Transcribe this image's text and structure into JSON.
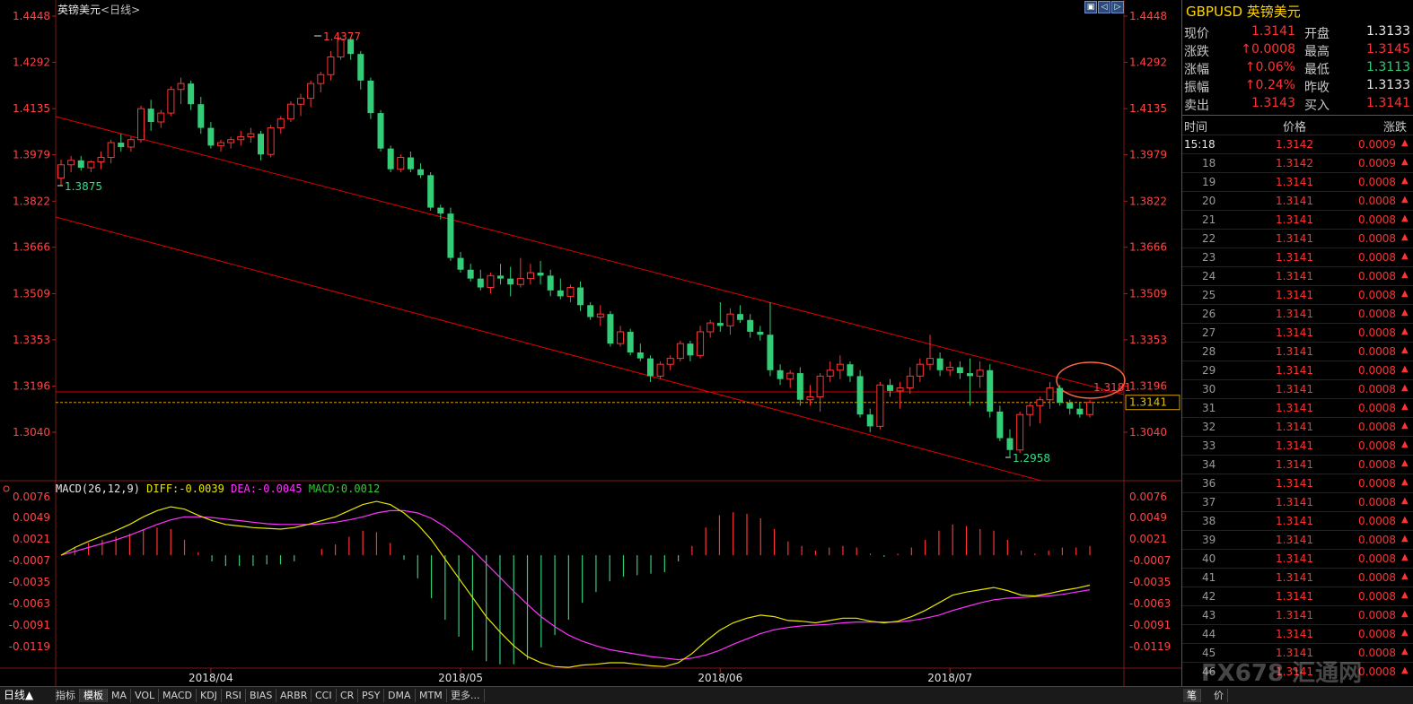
{
  "instrument": {
    "name": "英镑美元",
    "period": "<日线>"
  },
  "window_buttons": [
    "▣",
    "◁",
    "▷"
  ],
  "price_axis": [
    "1.4448",
    "1.4292",
    "1.4135",
    "1.3979",
    "1.3822",
    "1.3666",
    "1.3509",
    "1.3353",
    "1.3196",
    "1.3040"
  ],
  "macd_axis": [
    "0.0076",
    "0.0049",
    "0.0021",
    "-0.0007",
    "-0.0035",
    "-0.0063",
    "-0.0091",
    "-0.0119"
  ],
  "date_labels": [
    "2018/04",
    "2018/05",
    "2018/06",
    "2018/07"
  ],
  "annotations": {
    "high": "1.4377",
    "low": "1.2958",
    "start_low": "1.3875",
    "level": "1.3181",
    "last_price": "1.3141"
  },
  "macd_header": {
    "params": "MACD(26,12,9)",
    "diff": "DIFF:-0.0039",
    "dea": "DEA:-0.0045",
    "macd": "MACD:0.0012"
  },
  "colors": {
    "up": "#ff3333",
    "down": "#33cc77",
    "trendline": "#e00000",
    "diff": "#e6e600",
    "dea": "#ff33ff",
    "circle": "#ff6644"
  },
  "chart_data": {
    "type": "candlestick",
    "title": "英镑美元<日线>",
    "ylim": [
      1.2958,
      1.4448
    ],
    "candles": [
      [
        1.39,
        1.3962,
        1.3875,
        1.3945
      ],
      [
        1.3945,
        1.3975,
        1.392,
        1.396
      ],
      [
        1.396,
        1.3975,
        1.3925,
        1.3935
      ],
      [
        1.3935,
        1.396,
        1.392,
        1.3955
      ],
      [
        1.3955,
        1.399,
        1.393,
        1.397
      ],
      [
        1.397,
        1.403,
        1.395,
        1.402
      ],
      [
        1.402,
        1.405,
        1.399,
        1.4005
      ],
      [
        1.4005,
        1.404,
        1.399,
        1.403
      ],
      [
        1.403,
        1.4145,
        1.402,
        1.4135
      ],
      [
        1.4135,
        1.4165,
        1.406,
        1.409
      ],
      [
        1.409,
        1.413,
        1.407,
        1.412
      ],
      [
        1.412,
        1.421,
        1.411,
        1.42
      ],
      [
        1.42,
        1.424,
        1.415,
        1.422
      ],
      [
        1.422,
        1.423,
        1.413,
        1.415
      ],
      [
        1.415,
        1.4175,
        1.405,
        1.407
      ],
      [
        1.407,
        1.409,
        1.4,
        1.401
      ],
      [
        1.401,
        1.403,
        1.399,
        1.402
      ],
      [
        1.402,
        1.404,
        1.4,
        1.403
      ],
      [
        1.403,
        1.406,
        1.401,
        1.404
      ],
      [
        1.404,
        1.407,
        1.402,
        1.405
      ],
      [
        1.405,
        1.406,
        1.396,
        1.398
      ],
      [
        1.398,
        1.408,
        1.397,
        1.407
      ],
      [
        1.407,
        1.411,
        1.405,
        1.41
      ],
      [
        1.41,
        1.416,
        1.409,
        1.415
      ],
      [
        1.415,
        1.4185,
        1.411,
        1.417
      ],
      [
        1.417,
        1.423,
        1.414,
        1.422
      ],
      [
        1.422,
        1.426,
        1.419,
        1.425
      ],
      [
        1.425,
        1.433,
        1.423,
        1.431
      ],
      [
        1.431,
        1.4377,
        1.43,
        1.437
      ],
      [
        1.437,
        1.4375,
        1.43,
        1.432
      ],
      [
        1.432,
        1.433,
        1.42,
        1.423
      ],
      [
        1.423,
        1.424,
        1.41,
        1.412
      ],
      [
        1.412,
        1.413,
        1.399,
        1.4
      ],
      [
        1.4,
        1.401,
        1.392,
        1.393
      ],
      [
        1.393,
        1.398,
        1.392,
        1.397
      ],
      [
        1.397,
        1.399,
        1.392,
        1.393
      ],
      [
        1.393,
        1.395,
        1.39,
        1.391
      ],
      [
        1.391,
        1.392,
        1.379,
        1.38
      ],
      [
        1.38,
        1.381,
        1.376,
        1.378
      ],
      [
        1.378,
        1.38,
        1.362,
        1.363
      ],
      [
        1.363,
        1.365,
        1.358,
        1.359
      ],
      [
        1.359,
        1.361,
        1.355,
        1.356
      ],
      [
        1.356,
        1.359,
        1.352,
        1.353
      ],
      [
        1.353,
        1.358,
        1.351,
        1.357
      ],
      [
        1.357,
        1.361,
        1.354,
        1.356
      ],
      [
        1.356,
        1.36,
        1.35,
        1.354
      ],
      [
        1.354,
        1.363,
        1.353,
        1.356
      ],
      [
        1.356,
        1.361,
        1.354,
        1.358
      ],
      [
        1.358,
        1.362,
        1.354,
        1.357
      ],
      [
        1.357,
        1.359,
        1.35,
        1.352
      ],
      [
        1.352,
        1.356,
        1.349,
        1.35
      ],
      [
        1.35,
        1.354,
        1.348,
        1.353
      ],
      [
        1.353,
        1.355,
        1.345,
        1.347
      ],
      [
        1.347,
        1.348,
        1.342,
        1.343
      ],
      [
        1.343,
        1.347,
        1.34,
        1.344
      ],
      [
        1.344,
        1.345,
        1.333,
        1.334
      ],
      [
        1.334,
        1.34,
        1.333,
        1.338
      ],
      [
        1.338,
        1.339,
        1.33,
        1.331
      ],
      [
        1.331,
        1.334,
        1.328,
        1.329
      ],
      [
        1.329,
        1.33,
        1.321,
        1.323
      ],
      [
        1.323,
        1.328,
        1.322,
        1.327
      ],
      [
        1.327,
        1.33,
        1.325,
        1.329
      ],
      [
        1.329,
        1.335,
        1.328,
        1.334
      ],
      [
        1.334,
        1.335,
        1.328,
        1.33
      ],
      [
        1.33,
        1.34,
        1.329,
        1.338
      ],
      [
        1.338,
        1.342,
        1.336,
        1.341
      ],
      [
        1.341,
        1.348,
        1.338,
        1.34
      ],
      [
        1.34,
        1.346,
        1.337,
        1.344
      ],
      [
        1.344,
        1.347,
        1.341,
        1.342
      ],
      [
        1.342,
        1.344,
        1.336,
        1.338
      ],
      [
        1.338,
        1.34,
        1.335,
        1.337
      ],
      [
        1.337,
        1.348,
        1.323,
        1.325
      ],
      [
        1.325,
        1.327,
        1.32,
        1.322
      ],
      [
        1.322,
        1.325,
        1.319,
        1.324
      ],
      [
        1.324,
        1.326,
        1.313,
        1.315
      ],
      [
        1.315,
        1.32,
        1.313,
        1.316
      ],
      [
        1.316,
        1.324,
        1.311,
        1.323
      ],
      [
        1.323,
        1.328,
        1.321,
        1.325
      ],
      [
        1.325,
        1.33,
        1.322,
        1.327
      ],
      [
        1.327,
        1.328,
        1.321,
        1.323
      ],
      [
        1.323,
        1.325,
        1.309,
        1.31
      ],
      [
        1.31,
        1.312,
        1.304,
        1.306
      ],
      [
        1.306,
        1.321,
        1.305,
        1.32
      ],
      [
        1.32,
        1.322,
        1.316,
        1.318
      ],
      [
        1.318,
        1.321,
        1.312,
        1.319
      ],
      [
        1.319,
        1.326,
        1.317,
        1.323
      ],
      [
        1.323,
        1.329,
        1.321,
        1.327
      ],
      [
        1.327,
        1.337,
        1.325,
        1.329
      ],
      [
        1.329,
        1.331,
        1.323,
        1.325
      ],
      [
        1.325,
        1.328,
        1.323,
        1.326
      ],
      [
        1.326,
        1.328,
        1.322,
        1.324
      ],
      [
        1.324,
        1.329,
        1.313,
        1.323
      ],
      [
        1.323,
        1.328,
        1.319,
        1.325
      ],
      [
        1.325,
        1.327,
        1.309,
        1.311
      ],
      [
        1.311,
        1.313,
        1.301,
        1.302
      ],
      [
        1.302,
        1.305,
        1.2958,
        1.298
      ],
      [
        1.298,
        1.311,
        1.297,
        1.31
      ],
      [
        1.31,
        1.314,
        1.306,
        1.313
      ],
      [
        1.313,
        1.316,
        1.307,
        1.315
      ],
      [
        1.315,
        1.321,
        1.312,
        1.319
      ],
      [
        1.319,
        1.32,
        1.313,
        1.314
      ],
      [
        1.314,
        1.315,
        1.31,
        1.312
      ],
      [
        1.312,
        1.314,
        1.309,
        1.31
      ],
      [
        1.31,
        1.315,
        1.309,
        1.3141
      ]
    ],
    "macd": {
      "diff": [
        0.0,
        0.001,
        0.0018,
        0.0025,
        0.0032,
        0.004,
        0.005,
        0.0058,
        0.0063,
        0.006,
        0.0052,
        0.0045,
        0.004,
        0.0038,
        0.0036,
        0.0035,
        0.0034,
        0.0036,
        0.004,
        0.0045,
        0.005,
        0.0058,
        0.0066,
        0.007,
        0.0066,
        0.0055,
        0.004,
        0.002,
        -0.0005,
        -0.003,
        -0.0055,
        -0.008,
        -0.01,
        -0.0118,
        -0.0132,
        -0.014,
        -0.0145,
        -0.0146,
        -0.0143,
        -0.0142,
        -0.014,
        -0.014,
        -0.0142,
        -0.0144,
        -0.0145,
        -0.014,
        -0.0128,
        -0.0112,
        -0.0098,
        -0.0088,
        -0.0082,
        -0.0078,
        -0.008,
        -0.0085,
        -0.0086,
        -0.0088,
        -0.0085,
        -0.0082,
        -0.0082,
        -0.0086,
        -0.0088,
        -0.0086,
        -0.008,
        -0.0072,
        -0.0062,
        -0.0052,
        -0.0048,
        -0.0045,
        -0.0042,
        -0.0046,
        -0.0052,
        -0.0053,
        -0.005,
        -0.0046,
        -0.0043,
        -0.0039
      ],
      "dea": [
        0.0,
        0.0005,
        0.001,
        0.0015,
        0.002,
        0.0026,
        0.0033,
        0.004,
        0.0046,
        0.005,
        0.005,
        0.0049,
        0.0047,
        0.0045,
        0.0043,
        0.0041,
        0.004,
        0.004,
        0.004,
        0.0041,
        0.0043,
        0.0046,
        0.005,
        0.0055,
        0.0058,
        0.0058,
        0.0055,
        0.0048,
        0.0037,
        0.0023,
        0.0007,
        -0.0011,
        -0.0029,
        -0.0047,
        -0.0064,
        -0.008,
        -0.0093,
        -0.0104,
        -0.0112,
        -0.0118,
        -0.0123,
        -0.0126,
        -0.0129,
        -0.0132,
        -0.0134,
        -0.0136,
        -0.0134,
        -0.013,
        -0.0124,
        -0.0116,
        -0.0109,
        -0.0102,
        -0.0097,
        -0.0094,
        -0.0092,
        -0.0091,
        -0.009,
        -0.0088,
        -0.0087,
        -0.0087,
        -0.0087,
        -0.0087,
        -0.0085,
        -0.0082,
        -0.0078,
        -0.0072,
        -0.0067,
        -0.0062,
        -0.0058,
        -0.0056,
        -0.0055,
        -0.0054,
        -0.0053,
        -0.0051,
        -0.0048,
        -0.0045
      ]
    }
  },
  "quote": {
    "symbol": "GBPUSD",
    "name": "英镑美元",
    "rows": [
      {
        "l1": "现价",
        "v1": "1.3141",
        "l2": "开盘",
        "v2": "1.3133"
      },
      {
        "l1": "涨跌",
        "v1": "↑0.0008",
        "l2": "最高",
        "v2": "1.3145"
      },
      {
        "l1": "涨幅",
        "v1": "↑0.06%",
        "l2": "最低",
        "v2": "1.3113"
      },
      {
        "l1": "振幅",
        "v1": "↑0.24%",
        "l2": "昨收",
        "v2": "1.3133"
      },
      {
        "l1": "卖出",
        "v1": "1.3143",
        "l2": "买入",
        "v2": "1.3141"
      }
    ],
    "tick_headers": [
      "时间",
      "价格",
      "涨跌"
    ],
    "ticks": [
      {
        "t": "15:18",
        "p": "1.3142",
        "c": "0.0009"
      },
      {
        "t": "18",
        "p": "1.3142",
        "c": "0.0009"
      },
      {
        "t": "19",
        "p": "1.3141",
        "c": "0.0008"
      },
      {
        "t": "20",
        "p": "1.3141",
        "c": "0.0008"
      },
      {
        "t": "21",
        "p": "1.3141",
        "c": "0.0008"
      },
      {
        "t": "22",
        "p": "1.3141",
        "c": "0.0008"
      },
      {
        "t": "23",
        "p": "1.3141",
        "c": "0.0008"
      },
      {
        "t": "24",
        "p": "1.3141",
        "c": "0.0008"
      },
      {
        "t": "25",
        "p": "1.3141",
        "c": "0.0008"
      },
      {
        "t": "26",
        "p": "1.3141",
        "c": "0.0008"
      },
      {
        "t": "27",
        "p": "1.3141",
        "c": "0.0008"
      },
      {
        "t": "28",
        "p": "1.3141",
        "c": "0.0008"
      },
      {
        "t": "29",
        "p": "1.3141",
        "c": "0.0008"
      },
      {
        "t": "30",
        "p": "1.3141",
        "c": "0.0008"
      },
      {
        "t": "31",
        "p": "1.3141",
        "c": "0.0008"
      },
      {
        "t": "32",
        "p": "1.3141",
        "c": "0.0008"
      },
      {
        "t": "33",
        "p": "1.3141",
        "c": "0.0008"
      },
      {
        "t": "34",
        "p": "1.3141",
        "c": "0.0008"
      },
      {
        "t": "36",
        "p": "1.3141",
        "c": "0.0008"
      },
      {
        "t": "37",
        "p": "1.3141",
        "c": "0.0008"
      },
      {
        "t": "38",
        "p": "1.3141",
        "c": "0.0008"
      },
      {
        "t": "39",
        "p": "1.3141",
        "c": "0.0008"
      },
      {
        "t": "40",
        "p": "1.3141",
        "c": "0.0008"
      },
      {
        "t": "41",
        "p": "1.3141",
        "c": "0.0008"
      },
      {
        "t": "42",
        "p": "1.3141",
        "c": "0.0008"
      },
      {
        "t": "43",
        "p": "1.3141",
        "c": "0.0008"
      },
      {
        "t": "44",
        "p": "1.3141",
        "c": "0.0008"
      },
      {
        "t": "45",
        "p": "1.3141",
        "c": "0.0008"
      },
      {
        "t": "46",
        "p": "1.3141",
        "c": "0.0008"
      }
    ],
    "bottom_tabs": [
      "笔",
      "价"
    ]
  },
  "bottom_tabs": [
    "指标",
    "模板",
    "MA",
    "VOL",
    "MACD",
    "KDJ",
    "RSI",
    "BIAS",
    "ARBR",
    "CCI",
    "CR",
    "PSY",
    "DMA",
    "MTM",
    "更多..."
  ],
  "period_tab": "日线▲",
  "watermark": "FX678 汇通网"
}
